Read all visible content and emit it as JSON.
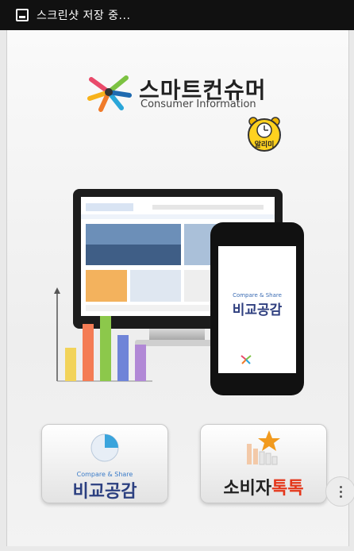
{
  "status_bar": {
    "text": "스크린샷 저장 중..."
  },
  "logo": {
    "title_ko": "스마트컨슈머",
    "subtitle_en": "Consumer Information"
  },
  "alarm_button": {
    "label": "알리미"
  },
  "phone_app": {
    "caption": "Compare & Share",
    "title": "비교공감"
  },
  "tiles": [
    {
      "caption": "Compare & Share",
      "label": "비교공감",
      "icon": "pie-chart-icon"
    },
    {
      "label_prefix": "소비자",
      "label_accent": "톡톡",
      "icon": "bar-chart-star-icon"
    }
  ],
  "colors": {
    "bar1": "#f2d35a",
    "bar2": "#f47c55",
    "bar3": "#8cc84b",
    "bar4": "#6f84d8",
    "bar5": "#b188d6",
    "tile_title_blue": "#2b3f80",
    "accent_red": "#e4361a"
  }
}
